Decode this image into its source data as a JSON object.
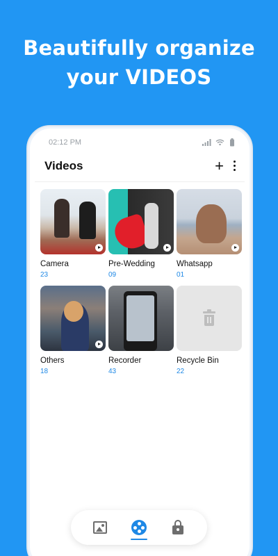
{
  "promo": {
    "line1": "Beautifully organize",
    "line2": "your VIDEOS"
  },
  "statusbar": {
    "time": "02:12 PM"
  },
  "appbar": {
    "title": "Videos",
    "add_symbol": "+"
  },
  "albums": [
    {
      "name": "Camera",
      "count": "23",
      "thumb_icon": "play-icon"
    },
    {
      "name": "Pre-Wedding",
      "count": "09",
      "thumb_icon": "play-icon"
    },
    {
      "name": "Whatsapp",
      "count": "01",
      "thumb_icon": "play-icon"
    },
    {
      "name": "Others",
      "count": "18",
      "thumb_icon": "play-icon"
    },
    {
      "name": "Recorder",
      "count": "43",
      "thumb_icon": "play-icon"
    },
    {
      "name": "Recycle Bin",
      "count": "22",
      "thumb_icon": "trash-icon"
    }
  ],
  "bottom_nav": {
    "items": [
      {
        "icon": "photo-icon",
        "active": false
      },
      {
        "icon": "video-reel-icon",
        "active": true
      },
      {
        "icon": "lock-icon",
        "active": false
      }
    ]
  },
  "colors": {
    "background": "#2196F3",
    "accent": "#1e88e5",
    "count_text": "#1e88e5"
  }
}
